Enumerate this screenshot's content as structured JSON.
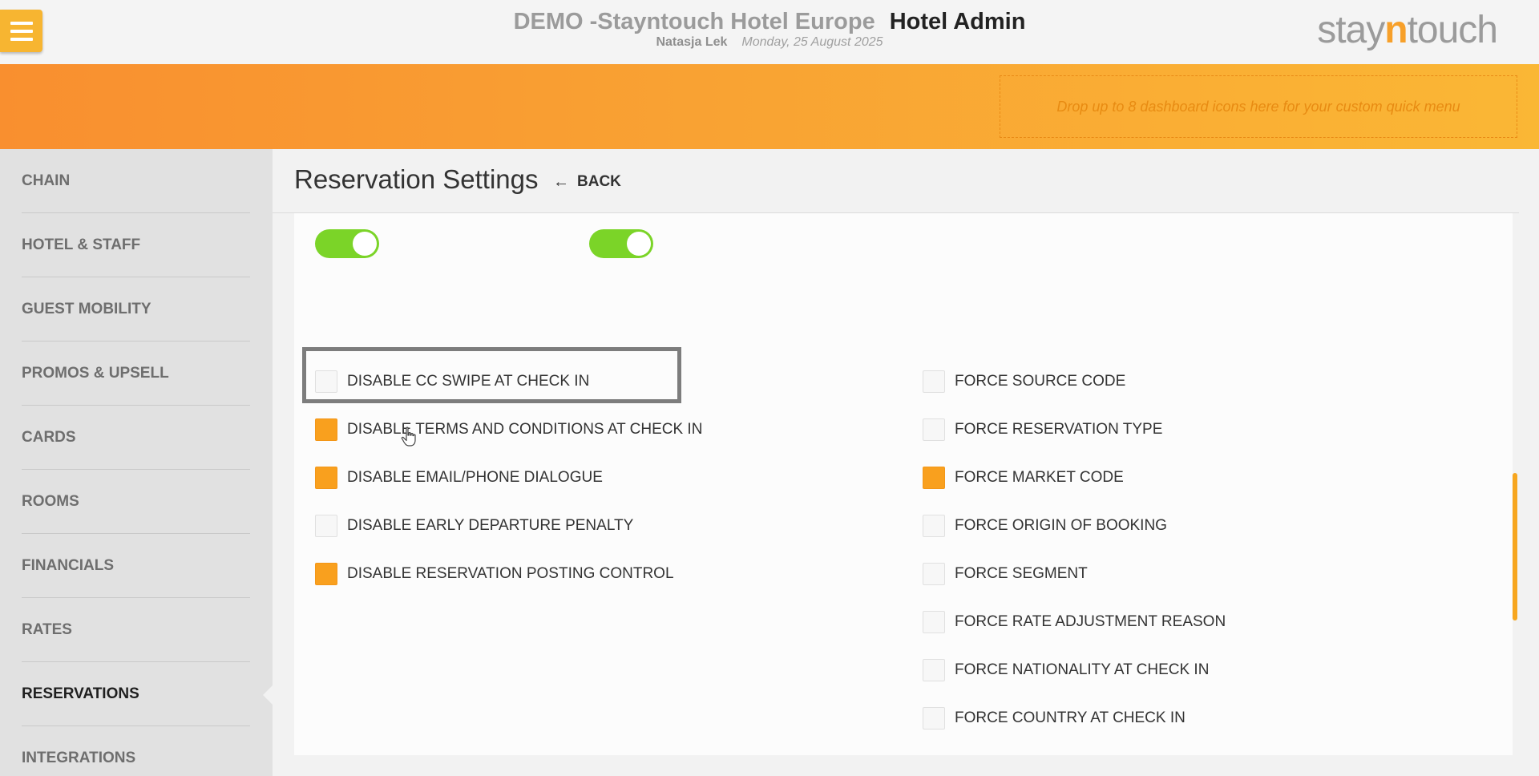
{
  "header": {
    "hotel_name": "DEMO -Stayntouch Hotel Europe",
    "app_name": "Hotel Admin",
    "user_name": "Natasja Lek",
    "date": "Monday, 25 August 2025",
    "logo": {
      "part1": "stay",
      "part2": "n",
      "part3": "touch"
    },
    "menu_icon": "hamburger-icon"
  },
  "quick_menu": {
    "placeholder": "Drop up to 8 dashboard icons here for your custom quick menu"
  },
  "sidebar": {
    "items": [
      {
        "label": "CHAIN",
        "active": false
      },
      {
        "label": "HOTEL & STAFF",
        "active": false
      },
      {
        "label": "GUEST MOBILITY",
        "active": false
      },
      {
        "label": "PROMOS & UPSELL",
        "active": false
      },
      {
        "label": "CARDS",
        "active": false
      },
      {
        "label": "ROOMS",
        "active": false
      },
      {
        "label": "FINANCIALS",
        "active": false
      },
      {
        "label": "RATES",
        "active": false
      },
      {
        "label": "RESERVATIONS",
        "active": true
      },
      {
        "label": "INTEGRATIONS",
        "active": false
      }
    ]
  },
  "page": {
    "title": "Reservation Settings",
    "back_label": "BACK",
    "back_icon": "arrow-left-icon"
  },
  "toggles": [
    {
      "on": true
    },
    {
      "on": true
    }
  ],
  "left_options": [
    {
      "label": "DISABLE CC SWIPE AT CHECK IN",
      "checked": false
    },
    {
      "label": "DISABLE TERMS AND CONDITIONS AT CHECK IN",
      "checked": true
    },
    {
      "label": "DISABLE EMAIL/PHONE DIALOGUE",
      "checked": true
    },
    {
      "label": "DISABLE EARLY DEPARTURE PENALTY",
      "checked": false
    },
    {
      "label": "DISABLE RESERVATION POSTING CONTROL",
      "checked": true
    }
  ],
  "right_options": [
    {
      "label": "FORCE SOURCE CODE",
      "checked": false
    },
    {
      "label": "FORCE RESERVATION TYPE",
      "checked": false
    },
    {
      "label": "FORCE MARKET CODE",
      "checked": true
    },
    {
      "label": "FORCE ORIGIN OF BOOKING",
      "checked": false
    },
    {
      "label": "FORCE SEGMENT",
      "checked": false
    },
    {
      "label": "FORCE RATE ADJUSTMENT REASON",
      "checked": false
    },
    {
      "label": "FORCE NATIONALITY AT CHECK IN",
      "checked": false
    },
    {
      "label": "FORCE COUNTRY AT CHECK IN",
      "checked": false
    }
  ],
  "colors": {
    "accent": "#f9a01e",
    "toggle_on": "#7bd428",
    "band_start": "#f98f2f",
    "band_end": "#fab735"
  }
}
